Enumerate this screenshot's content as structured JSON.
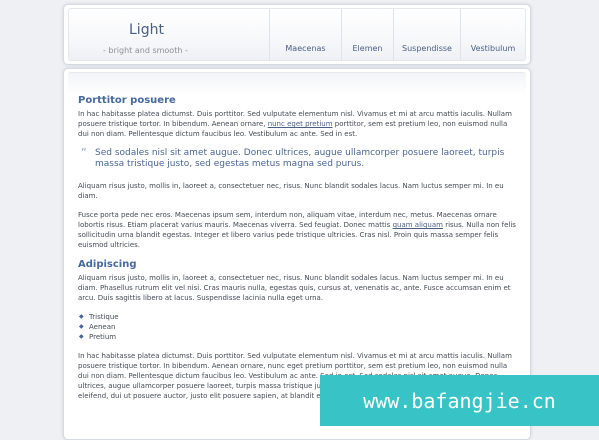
{
  "header": {
    "logo_title": "Light",
    "logo_subtitle": "- bright and smooth -",
    "nav": [
      "Maecenas",
      "Elemen",
      "Suspendisse",
      "Vestibulum"
    ]
  },
  "content": {
    "heading1": "Porttitor posuere",
    "p1_before_link": "In hac habitasse platea dictumst. Duis porttitor. Sed vulputate elementum nisl. Vivamus et mi at arcu mattis iaculis. Nullam posuere tristique tortor. In bibendum. Aenean ornare,",
    "p1_link": "nunc eget pretium",
    "p1_after_link": "porttitor, sem est pretium leo, non euismod nulla dui non diam. Pellentesque dictum faucibus leo. Vestibulum ac ante. Sed in est.",
    "quote": "Sed sodales nisl sit amet augue. Donec ultrices, augue ullamcorper posuere laoreet, turpis massa tristique justo, sed egestas metus magna sed purus.",
    "p2": "Aliquam risus justo, mollis in, laoreet a, consectetuer nec, risus. Nunc blandit sodales lacus. Nam luctus semper mi. In eu diam.",
    "p3_before_link": "Fusce porta pede nec eros. Maecenas ipsum sem, interdum non, aliquam vitae, interdum nec, metus. Maecenas ornare lobortis risus. Etiam placerat varius mauris. Maecenas viverra. Sed feugiat. Donec mattis",
    "p3_link": "quam aliquam",
    "p3_after_link": "risus. Nulla non felis sollicitudin urna blandit egestas. Integer et libero varius pede tristique ultricies. Cras nisl. Proin quis massa semper felis euismod ultricies.",
    "heading2": "Adipiscing",
    "p4": "Aliquam risus justo, mollis in, laoreet a, consectetuer nec, risus. Nunc blandit sodales lacus. Nam luctus semper mi. In eu diam. Phasellus rutrum elit vel nisi. Cras mauris nulla, egestas quis, cursus at, venenatis ac, ante. Fusce accumsan enim et arcu. Duis sagittis libero at lacus. Suspendisse lacinia nulla eget urna.",
    "list": [
      "Tristique",
      "Aenean",
      "Pretium"
    ],
    "p5": "In hac habitasse platea dictumst. Duis porttitor. Sed vulputate elementum nisl. Vivamus et mi at arcu mattis iaculis. Nullam posuere tristique tortor. In bibendum. Aenean ornare, nunc eget pretium porttitor, sem est pretium leo, non euismod nulla dui non diam. Pellentesque dictum faucibus leo. Vestibulum ac ante. Sed in est. Sed sodales nisl sit amet augue. Donec ultrices, augue ullamcorper posuere laoreet, turpis massa tristique justo, sed egestas metus magna sed purus. Fusce eleifend, dui ut posuere auctor, justo elit posuere sapien, at blandit enim quam fringilla mi."
  },
  "watermark": "www.bafangjie.cn"
}
